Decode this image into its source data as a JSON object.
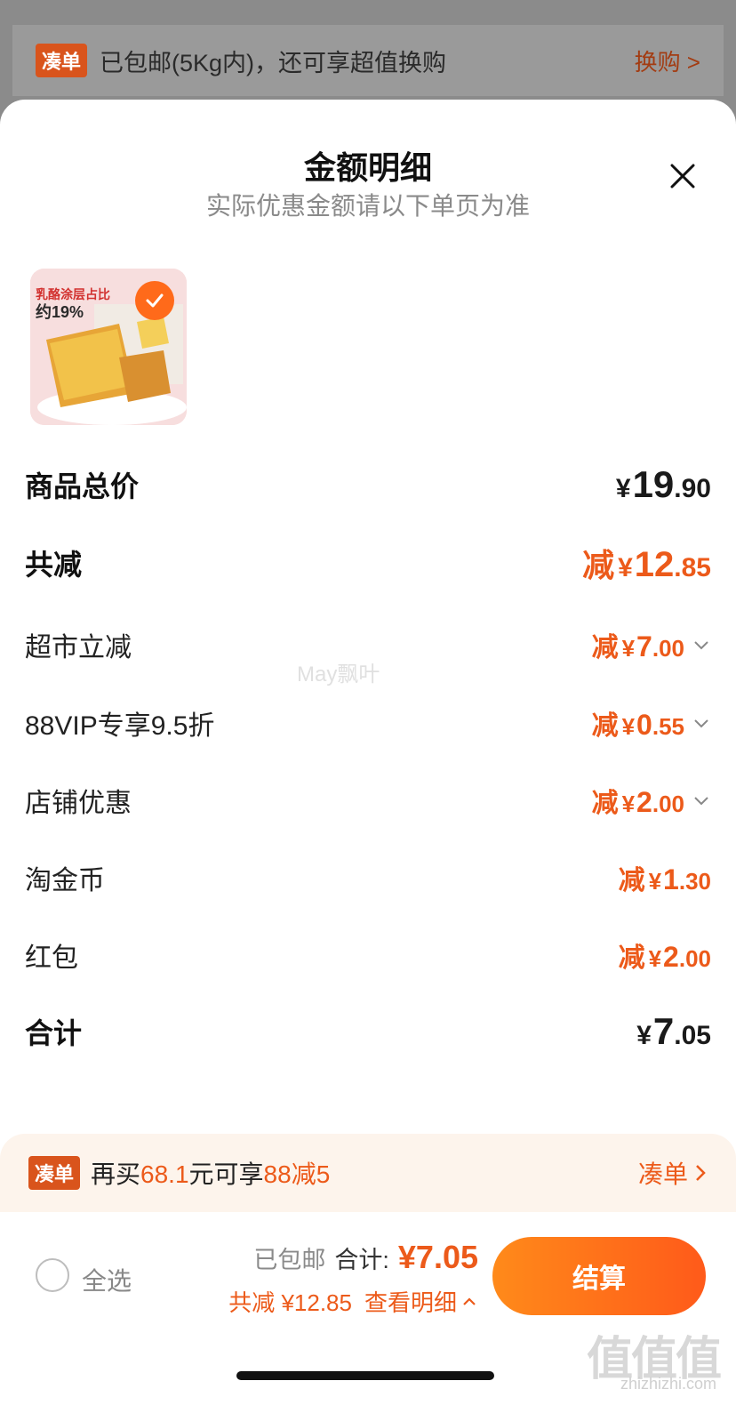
{
  "top_banner": {
    "tag": "凑单",
    "text": "已包邮(5Kg内)，还可享超值换购",
    "link": "换购 >"
  },
  "sheet": {
    "title": "金额明细",
    "subtitle": "实际优惠金额请以下单页为准",
    "close_icon": "close-icon"
  },
  "product": {
    "thumb_label_line1": "乳酪涂层占比",
    "thumb_label_line2": "约19%"
  },
  "rows": [
    {
      "label": "商品总价",
      "prefix": "",
      "yuan": "¥",
      "int": "19",
      "dec": ".90",
      "style": "black",
      "chevron": false,
      "bold": true
    },
    {
      "label": "共减",
      "prefix": "减",
      "yuan": "¥",
      "int": "12",
      "dec": ".85",
      "style": "orange",
      "chevron": false,
      "bold": true
    },
    {
      "label": "超市立减",
      "prefix": "减",
      "yuan": "¥",
      "int": "7",
      "dec": ".00",
      "style": "orange",
      "chevron": true,
      "bold": false
    },
    {
      "label": "88VIP专享9.5折",
      "prefix": "减",
      "yuan": "¥",
      "int": "0",
      "dec": ".55",
      "style": "orange",
      "chevron": true,
      "bold": false
    },
    {
      "label": "店铺优惠",
      "prefix": "减",
      "yuan": "¥",
      "int": "2",
      "dec": ".00",
      "style": "orange",
      "chevron": true,
      "bold": false
    },
    {
      "label": "淘金币",
      "prefix": "减",
      "yuan": "¥",
      "int": "1",
      "dec": ".30",
      "style": "orange",
      "chevron": false,
      "bold": false
    },
    {
      "label": "红包",
      "prefix": "减",
      "yuan": "¥",
      "int": "2",
      "dec": ".00",
      "style": "orange",
      "chevron": false,
      "bold": false
    },
    {
      "label": "合计",
      "prefix": "",
      "yuan": "¥",
      "int": "7",
      "dec": ".05",
      "style": "black",
      "chevron": false,
      "bold": true
    }
  ],
  "watermark": "May飘叶",
  "promo": {
    "tag": "凑单",
    "text_pre": "再买",
    "amount": "68.1",
    "text_mid": "元可享",
    "deal": "88减5",
    "link": "凑单"
  },
  "bottom": {
    "select_all": "全选",
    "free_shipping": "已包邮",
    "total_label": "合计:",
    "total_price": "¥7.05",
    "saved": "共减 ¥12.85",
    "details_link": "查看明细",
    "checkout": "结算"
  },
  "corner_logo": "值值值",
  "corner_sub": "zhizhizhi.com",
  "colors": {
    "accent": "#ec5a1a",
    "tag": "#d9541c"
  }
}
